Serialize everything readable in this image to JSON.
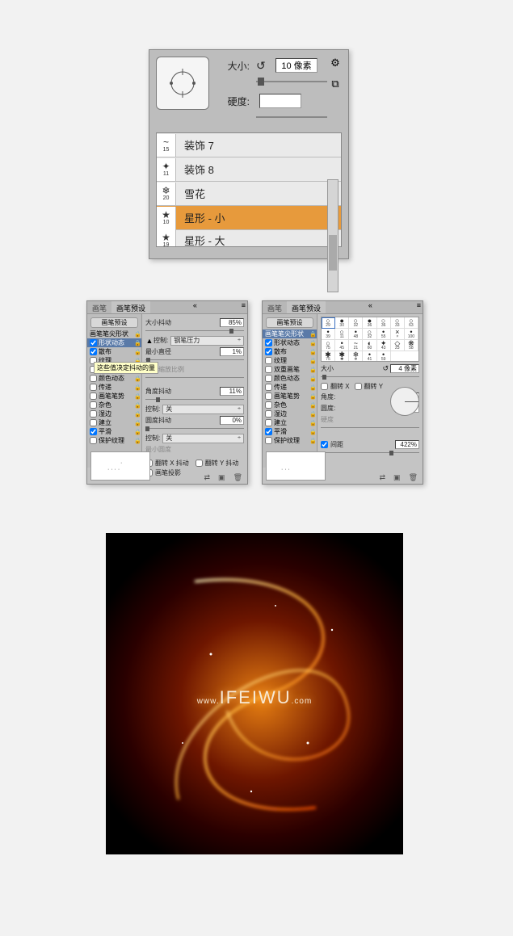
{
  "brush_picker": {
    "size_label": "大小:",
    "size_value": "10 像素",
    "hardness_label": "硬度:",
    "hardness_value": "",
    "gear_icon": "⚙",
    "new_icon": "⧉",
    "items": [
      {
        "glyph": "~",
        "num": "15",
        "name": "装饰 7"
      },
      {
        "glyph": "✦",
        "num": "11",
        "name": "装饰 8"
      },
      {
        "glyph": "❄",
        "num": "20",
        "name": "雪花"
      },
      {
        "glyph": "★",
        "num": "10",
        "name": "星形 - 小",
        "selected": true
      },
      {
        "glyph": "★",
        "num": "19",
        "name": "星形 - 大"
      }
    ]
  },
  "panel_tabs": {
    "t1": "画笔",
    "t2": "画笔预设"
  },
  "preset_button": "画笔预设",
  "side_options": [
    {
      "name": "画笔笔尖形状",
      "chk": false,
      "nocheck": true
    },
    {
      "name": "形状动态",
      "chk": true
    },
    {
      "name": "散布",
      "chk": true
    },
    {
      "name": "纹理",
      "chk": false
    },
    {
      "name": "双重画笔",
      "chk": false
    },
    {
      "name": "颜色动态",
      "chk": false
    },
    {
      "name": "传递",
      "chk": false
    },
    {
      "name": "画笔笔势",
      "chk": false
    },
    {
      "name": "杂色",
      "chk": false
    },
    {
      "name": "湿边",
      "chk": false
    },
    {
      "name": "建立",
      "chk": false
    },
    {
      "name": "平滑",
      "chk": true
    },
    {
      "name": "保护纹理",
      "chk": false
    }
  ],
  "tooltip": "这些值决定抖动的量",
  "left_panel": {
    "size_jitter": {
      "label": "大小抖动",
      "value": "85%"
    },
    "ctrl_label": "控制:",
    "ctrl1_value": "钢笔压力",
    "min_dia": {
      "label": "最小直径",
      "value": "1%"
    },
    "tilt_ratio": "倾斜缩放比例",
    "angle_jitter": {
      "label": "角度抖动",
      "value": "11%"
    },
    "ctrl2_value": "关",
    "round_jitter": {
      "label": "圆度抖动",
      "value": "0%"
    },
    "ctrl3_value": "关",
    "min_round": "最小圆度",
    "flipx": "翻转 X 抖动",
    "flipy": "翻转 Y 抖动",
    "brush_proj": "画笔投影"
  },
  "right_panel": {
    "grid_nums": [
      "29",
      "30",
      "32",
      "36",
      "36",
      "33",
      "63",
      "39",
      "11",
      "48",
      "32",
      "55",
      "×",
      "100",
      "75",
      "45",
      "21",
      "60",
      "43",
      "23",
      "58",
      "75",
      "✱",
      "❄",
      "41",
      "59"
    ],
    "size_label": "大小",
    "size_value": "4 像素",
    "flipx": "翻转 X",
    "flipy": "翻转 Y",
    "angle_label": "角度:",
    "angle_value": "0°",
    "round_label": "圆度:",
    "round_value": "100%",
    "hardness_label": "硬度",
    "spacing_label": "间距",
    "spacing_value": "422%"
  },
  "result": {
    "prefix": "www.",
    "main": "IFEIWU",
    "suffix": ".com"
  }
}
